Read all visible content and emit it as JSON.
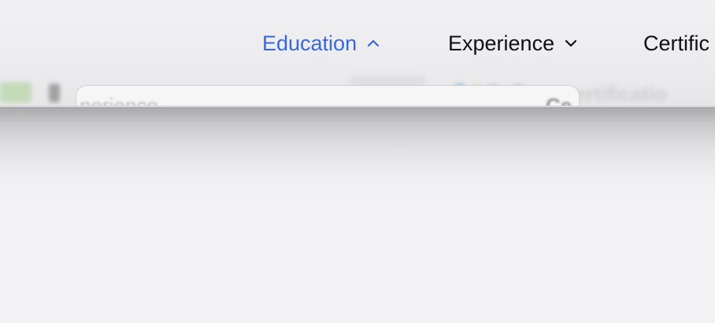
{
  "nav": {
    "items": [
      {
        "label": "Education",
        "state": "expanded",
        "icon": "chevron-up-icon"
      },
      {
        "label": "Experience",
        "state": "collapsed",
        "icon": "chevron-down-icon"
      },
      {
        "label": "Certific"
      }
    ]
  },
  "background": {
    "card_text_left": "perience",
    "card_text_right": "Ce",
    "strip_text_right": "ertificatio"
  },
  "colors": {
    "active": "#3a68d8",
    "text": "#111111",
    "page_background": "#f3f3f6"
  }
}
